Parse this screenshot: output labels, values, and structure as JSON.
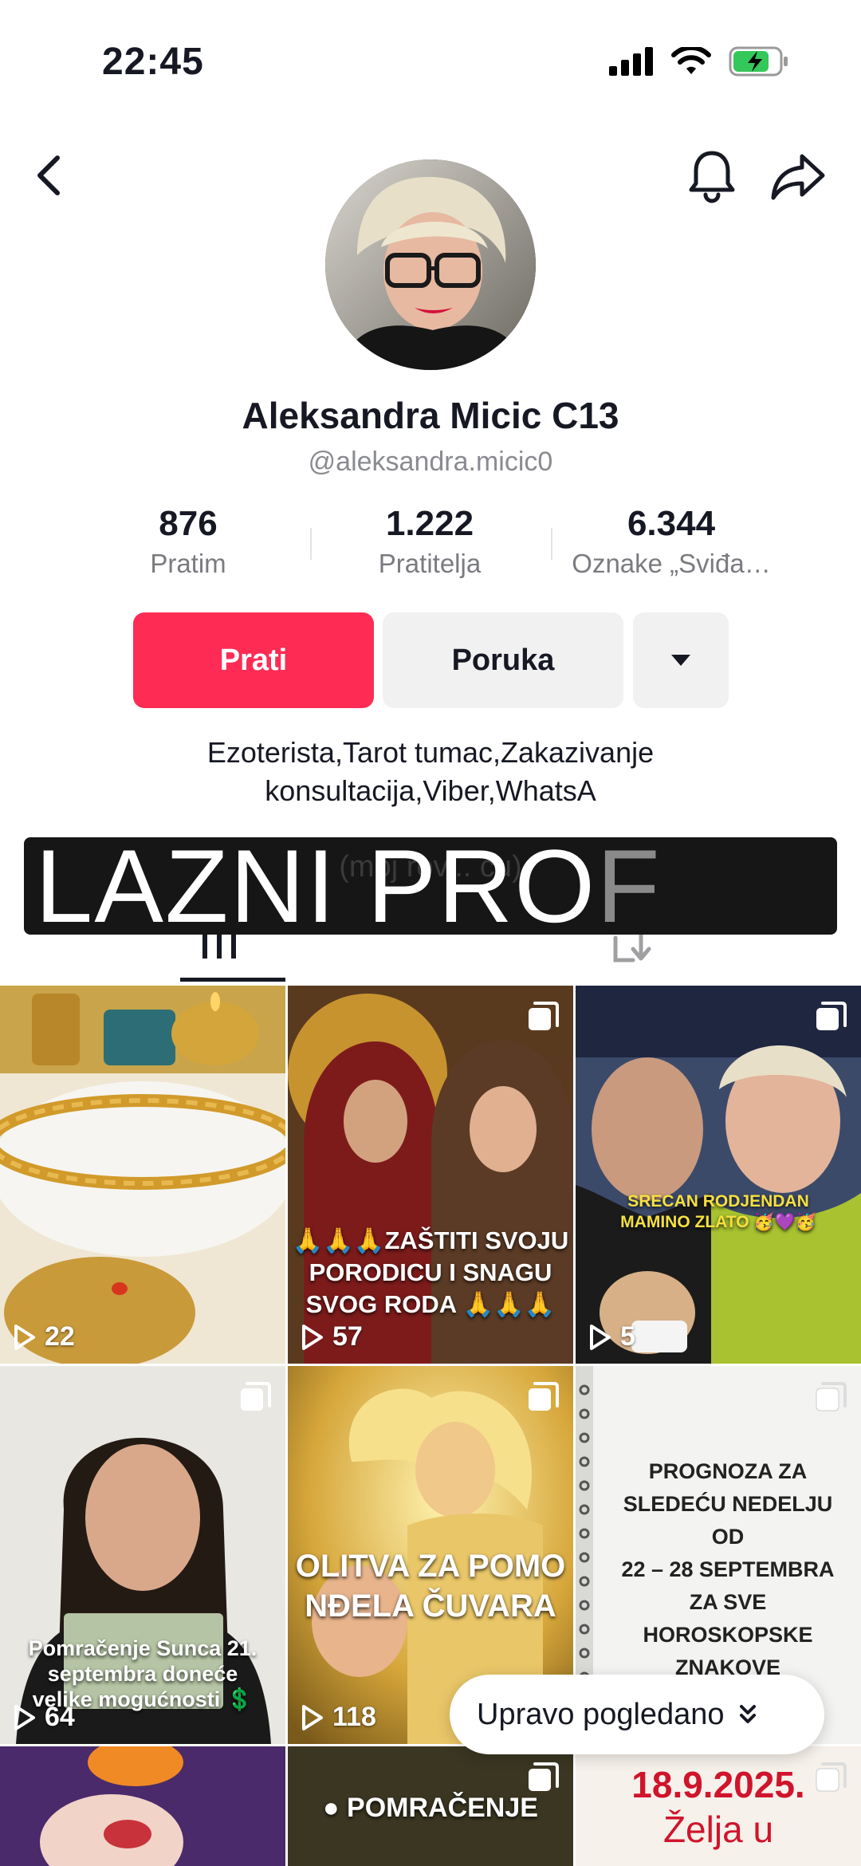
{
  "status_bar": {
    "time": "22:45"
  },
  "profile": {
    "display_name": "Aleksandra Micic C13",
    "username": "@aleksandra.micic0",
    "bio_line1": "Ezoterista,Tarot tumac,Zakazivanje",
    "bio_line2": "konsultacija,Viber,WhatsA"
  },
  "stats": [
    {
      "value": "876",
      "label": "Pratim"
    },
    {
      "value": "1.222",
      "label": "Pratitelja"
    },
    {
      "value": "6.344",
      "label": "Oznake „Sviđa…"
    }
  ],
  "actions": {
    "follow_label": "Prati",
    "message_label": "Poruka"
  },
  "overlay": {
    "hidden_text": "(moj rov... cu)",
    "main": "LAZNI PRO",
    "faded": "F"
  },
  "grid": [
    {
      "views": "22",
      "caption": ""
    },
    {
      "views": "57",
      "caption_lines": [
        "🙏🙏🙏ZAŠTITI SVOJU",
        "PORODICU I SNAGU",
        "SVOG RODA 🙏🙏🙏"
      ]
    },
    {
      "views": "5",
      "caption_lines": [
        "SRECAN RODJENDAN",
        "MAMINO ZLATO 🥳💜🥳"
      ]
    },
    {
      "views": "64",
      "caption_lines": [
        "Pomračenje Sunca 21.",
        "septembra doneće",
        "velike mogućnosti 💲"
      ]
    },
    {
      "views": "118",
      "caption_lines": [
        "OLITVA ZA POMO",
        "NĐELA ČUVARA"
      ]
    },
    {
      "views": "",
      "caption_lines": [
        "PROGNOZA ZA",
        "SLEDEĆU NEDELJU",
        "OD",
        "22 – 28 SEPTEMBRA",
        "ZA SVE",
        "HOROSKOPSKE",
        "ZNAKOVE"
      ]
    },
    {
      "views": "",
      "caption": ""
    },
    {
      "views": "",
      "caption": "● POMRAČENJE"
    },
    {
      "views": "",
      "caption_lines": [
        "18.9.2025.",
        "Želja u"
      ]
    }
  ],
  "recently_viewed": {
    "label": "Upravo pogledano"
  },
  "colors": {
    "accent": "#fe2c55",
    "secondary_button": "#f1f1f2",
    "text_primary": "#161823",
    "text_secondary": "#8a8b91"
  }
}
